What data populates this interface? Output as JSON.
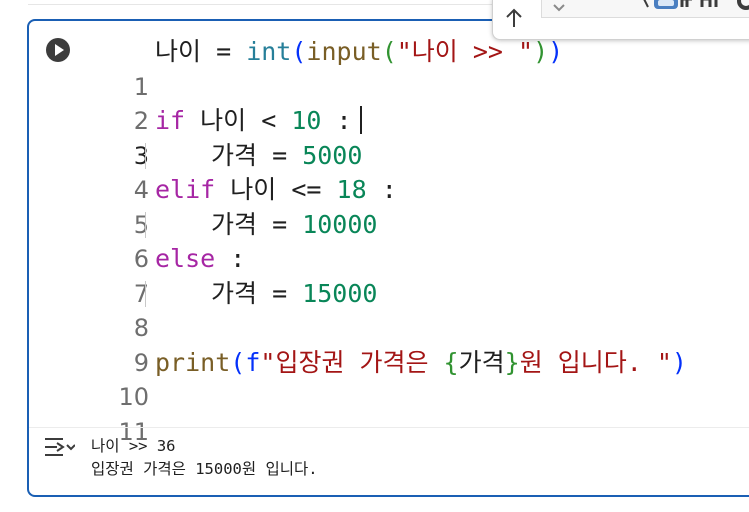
{
  "code_lines": [
    {
      "number": "1",
      "parts": {
        "var": "나이",
        "eq": "=",
        "int": "int",
        "p1": "(",
        "input": "input",
        "p2": "(",
        "str": "\"나이 >> \"",
        "p3": ")",
        "p4": ")"
      }
    },
    {
      "number": "2"
    },
    {
      "number": "3",
      "parts": {
        "kw": "if",
        "var": "나이",
        "op": "<",
        "num": "10",
        "colon": ":"
      }
    },
    {
      "number": "4",
      "parts": {
        "var": "가격",
        "eq": "=",
        "num": "5000"
      }
    },
    {
      "number": "5",
      "parts": {
        "kw": "elif",
        "var": "나이",
        "op": "<=",
        "num": "18",
        "colon": ":"
      }
    },
    {
      "number": "6",
      "parts": {
        "var": "가격",
        "eq": "=",
        "num": "10000"
      }
    },
    {
      "number": "7",
      "parts": {
        "kw": "else",
        "colon": ":"
      }
    },
    {
      "number": "8",
      "parts": {
        "var": "가격",
        "eq": "=",
        "num": "15000"
      }
    },
    {
      "number": "9"
    },
    {
      "number": "10",
      "parts": {
        "print": "print",
        "p1": "(",
        "prefix": "f",
        "str1": "\"입장권 가격은 ",
        "b1": "{",
        "var": "가격",
        "b2": "}",
        "str2": "원 입니다. \"",
        "p2": ")"
      }
    },
    {
      "number": "11"
    }
  ],
  "output": {
    "lines": [
      "나이 >> 36",
      "입장권 가격은 15000원 입니다."
    ]
  },
  "icons": {
    "run": "play-circle-icon",
    "output": "output-toggle-icon",
    "move_up": "arrow-up-icon",
    "move_down": "chevron-down-icon"
  },
  "colors": {
    "cell_border": "#1a5fb4",
    "keyword": "#a626a4",
    "function": "#795e26",
    "builtin": "#267f99",
    "number": "#098658",
    "string": "#a31515",
    "paren": "#0431fa",
    "brace": "#319331"
  }
}
